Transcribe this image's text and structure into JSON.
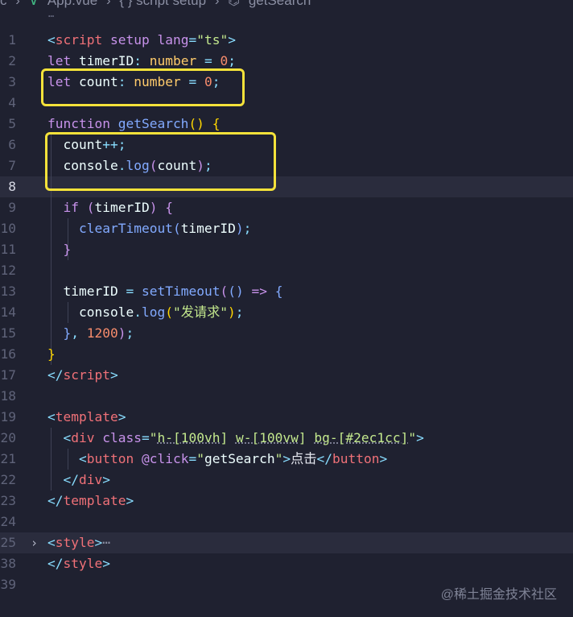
{
  "breadcrumb": {
    "folder": "c",
    "file": "App.vue",
    "section": "{ } script setup",
    "symbol": "getSearch"
  },
  "sticky_marker": "…",
  "lines": [
    {
      "n": "1",
      "tokens": [
        [
          "tag",
          "<"
        ],
        [
          "tn",
          "script"
        ],
        [
          "plain",
          " "
        ],
        [
          "attr",
          "setup"
        ],
        [
          "plain",
          " "
        ],
        [
          "attr",
          "lang"
        ],
        [
          "punc",
          "="
        ],
        [
          "str",
          "\"ts\""
        ],
        [
          "tag",
          ">"
        ]
      ]
    },
    {
      "n": "2",
      "tokens": [
        [
          "kw",
          "let"
        ],
        [
          "plain",
          " "
        ],
        [
          "id",
          "timerID"
        ],
        [
          "punc",
          ":"
        ],
        [
          "plain",
          " "
        ],
        [
          "typ",
          "number"
        ],
        [
          "plain",
          " "
        ],
        [
          "punc",
          "="
        ],
        [
          "plain",
          " "
        ],
        [
          "num",
          "0"
        ],
        [
          "punc",
          ";"
        ]
      ]
    },
    {
      "n": "3",
      "tokens": [
        [
          "kw",
          "let"
        ],
        [
          "plain",
          " "
        ],
        [
          "id",
          "count"
        ],
        [
          "punc",
          ":"
        ],
        [
          "plain",
          " "
        ],
        [
          "typ",
          "number"
        ],
        [
          "plain",
          " "
        ],
        [
          "punc",
          "="
        ],
        [
          "plain",
          " "
        ],
        [
          "num",
          "0"
        ],
        [
          "punc",
          ";"
        ]
      ]
    },
    {
      "n": "4",
      "tokens": []
    },
    {
      "n": "5",
      "tokens": [
        [
          "kw",
          "function"
        ],
        [
          "plain",
          " "
        ],
        [
          "fn",
          "getSearch"
        ],
        [
          "brk",
          "()"
        ],
        [
          "plain",
          " "
        ],
        [
          "brk",
          "{"
        ]
      ]
    },
    {
      "n": "6",
      "tokens": [
        [
          "plain",
          "  "
        ],
        [
          "id",
          "count"
        ],
        [
          "punc",
          "++"
        ],
        [
          "punc",
          ";"
        ]
      ]
    },
    {
      "n": "7",
      "tokens": [
        [
          "plain",
          "  "
        ],
        [
          "id",
          "console"
        ],
        [
          "punc",
          "."
        ],
        [
          "fn",
          "log"
        ],
        [
          "kw",
          "("
        ],
        [
          "id",
          "count"
        ],
        [
          "kw",
          ")"
        ],
        [
          "punc",
          ";"
        ]
      ]
    },
    {
      "n": "8",
      "tokens": [],
      "active": true
    },
    {
      "n": "9",
      "tokens": [
        [
          "plain",
          "  "
        ],
        [
          "kw",
          "if"
        ],
        [
          "plain",
          " "
        ],
        [
          "kw",
          "("
        ],
        [
          "id",
          "timerID"
        ],
        [
          "kw",
          ")"
        ],
        [
          "plain",
          " "
        ],
        [
          "kw",
          "{"
        ]
      ]
    },
    {
      "n": "10",
      "tokens": [
        [
          "plain",
          "    "
        ],
        [
          "fn",
          "clearTimeout"
        ],
        [
          "fn",
          "("
        ],
        [
          "id",
          "timerID"
        ],
        [
          "fn",
          ")"
        ],
        [
          "punc",
          ";"
        ]
      ]
    },
    {
      "n": "11",
      "tokens": [
        [
          "plain",
          "  "
        ],
        [
          "kw",
          "}"
        ]
      ]
    },
    {
      "n": "12",
      "tokens": []
    },
    {
      "n": "13",
      "tokens": [
        [
          "plain",
          "  "
        ],
        [
          "id",
          "timerID"
        ],
        [
          "plain",
          " "
        ],
        [
          "punc",
          "="
        ],
        [
          "plain",
          " "
        ],
        [
          "fn",
          "setTimeout"
        ],
        [
          "kw",
          "("
        ],
        [
          "fn",
          "()"
        ],
        [
          "plain",
          " "
        ],
        [
          "kw",
          "=>"
        ],
        [
          "plain",
          " "
        ],
        [
          "fn",
          "{"
        ]
      ]
    },
    {
      "n": "14",
      "tokens": [
        [
          "plain",
          "    "
        ],
        [
          "id",
          "console"
        ],
        [
          "punc",
          "."
        ],
        [
          "fn",
          "log"
        ],
        [
          "brk",
          "("
        ],
        [
          "str",
          "\"发请求\""
        ],
        [
          "brk",
          ")"
        ],
        [
          "punc",
          ";"
        ]
      ]
    },
    {
      "n": "15",
      "tokens": [
        [
          "plain",
          "  "
        ],
        [
          "fn",
          "}"
        ],
        [
          "punc",
          ","
        ],
        [
          "plain",
          " "
        ],
        [
          "num",
          "1200"
        ],
        [
          "kw",
          ")"
        ],
        [
          "punc",
          ";"
        ]
      ]
    },
    {
      "n": "16",
      "tokens": [
        [
          "brk",
          "}"
        ]
      ]
    },
    {
      "n": "17",
      "tokens": [
        [
          "tag",
          "</"
        ],
        [
          "tn",
          "script"
        ],
        [
          "tag",
          ">"
        ]
      ]
    },
    {
      "n": "18",
      "tokens": []
    },
    {
      "n": "19",
      "tokens": [
        [
          "tag",
          "<"
        ],
        [
          "tn",
          "template"
        ],
        [
          "tag",
          ">"
        ]
      ]
    },
    {
      "n": "20",
      "tokens": [
        [
          "plain",
          "  "
        ],
        [
          "tag",
          "<"
        ],
        [
          "tn",
          "div"
        ],
        [
          "plain",
          " "
        ],
        [
          "attr",
          "class"
        ],
        [
          "punc",
          "="
        ],
        [
          "str",
          "\""
        ],
        [
          "str ul",
          "h-[100vh]"
        ],
        [
          "str",
          " "
        ],
        [
          "str ul",
          "w-[100vw]"
        ],
        [
          "str",
          " "
        ],
        [
          "str ul",
          "bg-[#2ec1cc]"
        ],
        [
          "str",
          "\""
        ],
        [
          "tag",
          ">"
        ]
      ]
    },
    {
      "n": "21",
      "tokens": [
        [
          "plain",
          "    "
        ],
        [
          "tag",
          "<"
        ],
        [
          "tn",
          "button"
        ],
        [
          "plain",
          " "
        ],
        [
          "attr",
          "@click"
        ],
        [
          "punc",
          "="
        ],
        [
          "str",
          "\""
        ],
        [
          "id",
          "getSearch"
        ],
        [
          "str",
          "\""
        ],
        [
          "tag",
          ">"
        ],
        [
          "plain",
          "点击"
        ],
        [
          "tag",
          "</"
        ],
        [
          "tn",
          "button"
        ],
        [
          "tag",
          ">"
        ]
      ]
    },
    {
      "n": "22",
      "tokens": [
        [
          "plain",
          "  "
        ],
        [
          "tag",
          "</"
        ],
        [
          "tn",
          "div"
        ],
        [
          "tag",
          ">"
        ]
      ]
    },
    {
      "n": "23",
      "tokens": [
        [
          "tag",
          "</"
        ],
        [
          "tn",
          "template"
        ],
        [
          "tag",
          ">"
        ]
      ]
    },
    {
      "n": "24",
      "tokens": []
    },
    {
      "n": "25",
      "tokens": [
        [
          "tag",
          "<"
        ],
        [
          "tn",
          "style"
        ],
        [
          "tag",
          ">"
        ],
        [
          "collapsed",
          "⋯"
        ]
      ],
      "fold": "›",
      "active": true
    },
    {
      "n": "38",
      "tokens": [
        [
          "tag",
          "</"
        ],
        [
          "tn",
          "style"
        ],
        [
          "tag",
          ">"
        ]
      ]
    },
    {
      "n": "39",
      "tokens": []
    }
  ],
  "highlight_color": "#f5e23a",
  "watermark": "@稀土掘金技术社区"
}
